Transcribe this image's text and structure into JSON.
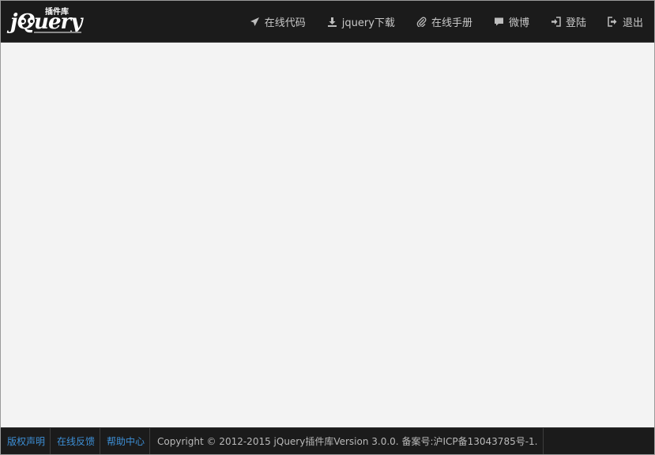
{
  "header": {
    "logo_text": "jQuery",
    "logo_badge": "插件库",
    "nav": [
      {
        "label": "在线代码",
        "icon": "send-icon"
      },
      {
        "label": "jquery下载",
        "icon": "download-icon"
      },
      {
        "label": "在线手册",
        "icon": "paperclip-icon"
      },
      {
        "label": "微博",
        "icon": "comment-icon"
      },
      {
        "label": "登陆",
        "icon": "login-icon"
      },
      {
        "label": "退出",
        "icon": "logout-icon"
      }
    ]
  },
  "footer": {
    "links": [
      {
        "label": "版权声明"
      },
      {
        "label": "在线反馈"
      },
      {
        "label": "帮助中心"
      }
    ],
    "copyright": "Copyright © 2012-2015 jQuery插件库Version 3.0.0. 备案号:沪ICP备13043785号-1."
  },
  "colors": {
    "bar_bg": "#1b1b1b",
    "nav_text": "#c8c8c8",
    "link": "#3d8fd6",
    "content_bg": "#f3f3f3"
  }
}
